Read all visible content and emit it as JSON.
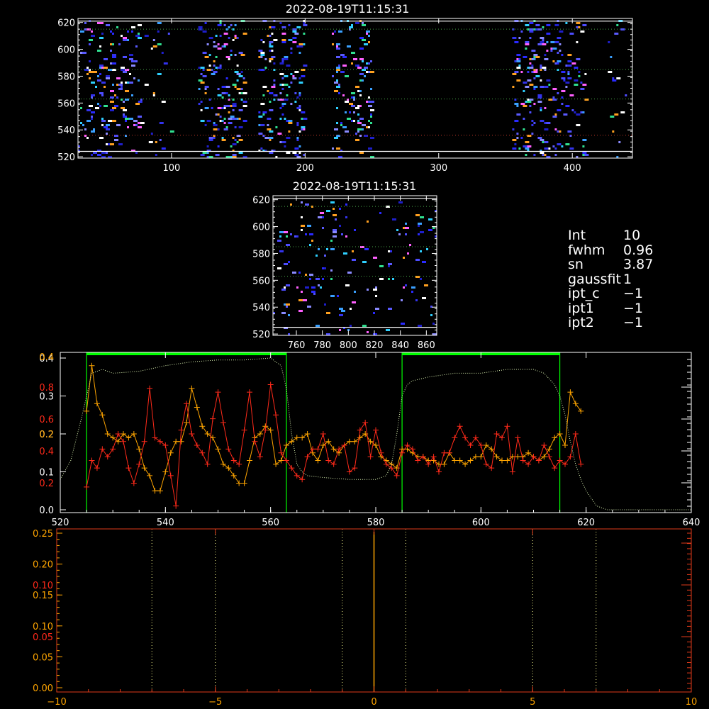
{
  "colors": {
    "axis": "#ffffff",
    "green_dotted": "#4aa84a",
    "red_dotted": "#c0392b",
    "orange": "#ffa500",
    "red": "#ff2a1a",
    "red_axis": "#e03a1a",
    "yellow_dotted": "#f5f58a",
    "lime": "#00ff00",
    "curve_dotted": "#d9f0b0"
  },
  "params": [
    {
      "key": "Int",
      "value": "10"
    },
    {
      "key": "fwhm",
      "value": "0.96"
    },
    {
      "key": "sn",
      "value": "3.87"
    },
    {
      "key": "gaussfit",
      "value": "1"
    },
    {
      "key": "ipt_c",
      "value": "−1"
    },
    {
      "key": "ipt1",
      "value": "−1"
    },
    {
      "key": "ipt2",
      "value": "−1"
    }
  ],
  "chart_data": [
    {
      "type": "heatmap",
      "title": "2022-08-19T11:15:31",
      "xlim": [
        30,
        445
      ],
      "ylim": [
        519,
        623
      ],
      "xticks": [
        100,
        200,
        300,
        400
      ],
      "yticks": [
        520,
        540,
        560,
        580,
        600,
        620
      ],
      "hlines_white": [
        621,
        524
      ],
      "hlines_green": [
        615,
        585,
        563
      ],
      "hlines_red": [
        536
      ],
      "pixel_columns": [
        {
          "x_range": [
            30,
            75
          ],
          "density": 0.3
        },
        {
          "x_range": [
            75,
            100
          ],
          "density": 0.1
        },
        {
          "x_range": [
            120,
            155
          ],
          "density": 0.35
        },
        {
          "x_range": [
            165,
            200
          ],
          "density": 0.35
        },
        {
          "x_range": [
            220,
            250
          ],
          "density": 0.4
        },
        {
          "x_range": [
            355,
            390
          ],
          "density": 0.4
        },
        {
          "x_range": [
            390,
            410
          ],
          "density": 0.25
        },
        {
          "x_range": [
            425,
            440
          ],
          "density": 0.08
        }
      ]
    },
    {
      "type": "heatmap",
      "title": "2022-08-19T11:15:31",
      "xlim": [
        742,
        868
      ],
      "ylim": [
        519,
        623
      ],
      "xticks": [
        760,
        780,
        800,
        820,
        840,
        860
      ],
      "yticks": [
        520,
        540,
        560,
        580,
        600,
        620
      ],
      "hlines_white": [
        621,
        525
      ],
      "hlines_green": [
        615,
        585,
        563
      ],
      "hlines_red": [],
      "pixel_columns": [
        {
          "x_range": [
            742,
            868
          ],
          "density": 0.12
        }
      ]
    },
    {
      "type": "line",
      "xlim": [
        520,
        640
      ],
      "xticks": [
        520,
        540,
        560,
        580,
        600,
        620,
        640
      ],
      "left_axis_white": {
        "ylim": [
          0,
          0.4
        ],
        "ticks": [
          0.0,
          0.1,
          0.2,
          0.3,
          0.4
        ]
      },
      "left_axis_red": {
        "ticks": [
          0.2,
          0.4,
          0.6,
          0.8
        ]
      },
      "left_axis_orange": {
        "ticks": [
          0.2,
          0.4
        ]
      },
      "vlines": [
        525,
        563,
        585,
        615
      ],
      "bands": [
        [
          525,
          563
        ],
        [
          585,
          615
        ]
      ],
      "series": [
        {
          "color": "orange",
          "x": [
            525,
            526,
            527,
            528,
            529,
            530,
            531,
            532,
            533,
            534,
            535,
            536,
            537,
            538,
            539,
            540,
            541,
            542,
            543,
            544,
            545,
            546,
            547,
            548,
            549,
            550,
            551,
            552,
            553,
            554,
            555,
            556,
            557,
            558,
            559,
            560,
            561,
            562,
            563,
            564,
            565,
            566,
            567,
            568,
            569,
            570,
            571,
            572,
            573,
            574,
            575,
            576,
            577,
            578,
            579,
            580,
            581,
            582,
            583,
            584,
            585,
            586,
            587,
            588,
            589,
            590,
            591,
            592,
            593,
            594,
            595,
            596,
            597,
            598,
            599,
            600,
            601,
            602,
            603,
            604,
            605,
            606,
            607,
            608,
            609,
            610,
            611,
            612,
            613,
            614,
            615,
            616,
            617,
            618,
            619
          ],
          "y": [
            0.26,
            0.38,
            0.28,
            0.25,
            0.2,
            0.19,
            0.18,
            0.2,
            0.19,
            0.2,
            0.16,
            0.11,
            0.09,
            0.05,
            0.05,
            0.1,
            0.15,
            0.18,
            0.18,
            0.23,
            0.32,
            0.27,
            0.22,
            0.2,
            0.19,
            0.16,
            0.12,
            0.11,
            0.09,
            0.07,
            0.07,
            0.13,
            0.19,
            0.2,
            0.22,
            0.21,
            0.12,
            0.13,
            0.17,
            0.18,
            0.19,
            0.19,
            0.2,
            0.15,
            0.13,
            0.17,
            0.18,
            0.16,
            0.15,
            0.17,
            0.18,
            0.18,
            0.19,
            0.2,
            0.18,
            0.17,
            0.14,
            0.13,
            0.12,
            0.11,
            0.16,
            0.16,
            0.15,
            0.14,
            0.14,
            0.13,
            0.13,
            0.12,
            0.12,
            0.15,
            0.13,
            0.13,
            0.12,
            0.13,
            0.14,
            0.14,
            0.17,
            0.16,
            0.14,
            0.13,
            0.13,
            0.14,
            0.14,
            0.14,
            0.15,
            0.14,
            0.13,
            0.14,
            0.16,
            0.19,
            0.2,
            0.17,
            0.31,
            0.28,
            0.26
          ]
        },
        {
          "color": "red",
          "x": [
            525,
            526,
            527,
            528,
            529,
            530,
            531,
            532,
            533,
            534,
            535,
            536,
            537,
            538,
            539,
            540,
            541,
            542,
            543,
            544,
            545,
            546,
            547,
            548,
            549,
            550,
            551,
            552,
            553,
            554,
            555,
            556,
            557,
            558,
            559,
            560,
            561,
            562,
            563,
            564,
            565,
            566,
            567,
            568,
            569,
            570,
            571,
            572,
            573,
            574,
            575,
            576,
            577,
            578,
            579,
            580,
            581,
            582,
            583,
            584,
            585,
            586,
            587,
            588,
            589,
            590,
            591,
            592,
            593,
            594,
            595,
            596,
            597,
            598,
            599,
            600,
            601,
            602,
            603,
            604,
            605,
            606,
            607,
            608,
            609,
            610,
            611,
            612,
            613,
            614,
            615,
            616,
            617,
            618,
            619
          ],
          "y": [
            0.06,
            0.13,
            0.11,
            0.16,
            0.14,
            0.16,
            0.2,
            0.18,
            0.11,
            0.07,
            0.12,
            0.18,
            0.32,
            0.19,
            0.18,
            0.17,
            0.09,
            0.01,
            0.21,
            0.28,
            0.2,
            0.17,
            0.15,
            0.12,
            0.24,
            0.31,
            0.23,
            0.16,
            0.13,
            0.12,
            0.21,
            0.31,
            0.18,
            0.14,
            0.21,
            0.33,
            0.25,
            0.15,
            0.13,
            0.11,
            0.09,
            0.08,
            0.14,
            0.16,
            0.16,
            0.2,
            0.13,
            0.12,
            0.16,
            0.17,
            0.1,
            0.11,
            0.21,
            0.23,
            0.14,
            0.21,
            0.15,
            0.12,
            0.11,
            0.09,
            0.15,
            0.17,
            0.16,
            0.13,
            0.14,
            0.12,
            0.14,
            0.1,
            0.15,
            0.15,
            0.19,
            0.22,
            0.19,
            0.17,
            0.19,
            0.17,
            0.12,
            0.11,
            0.2,
            0.19,
            0.22,
            0.1,
            0.19,
            0.13,
            0.12,
            0.14,
            0.13,
            0.17,
            0.14,
            0.11,
            0.13,
            0.12,
            0.14,
            0.2,
            0.12
          ]
        },
        {
          "color": "curve_dotted",
          "x": [
            520,
            522,
            524,
            525,
            526,
            528,
            530,
            535,
            540,
            545,
            550,
            555,
            560,
            562,
            563,
            564,
            565,
            566,
            567,
            570,
            575,
            580,
            582,
            583,
            584,
            585,
            586,
            587,
            590,
            595,
            600,
            605,
            610,
            612,
            614,
            615,
            616,
            617,
            618,
            619,
            620,
            622,
            624,
            626,
            630,
            635,
            640
          ],
          "y": [
            0.08,
            0.13,
            0.24,
            0.3,
            0.36,
            0.37,
            0.36,
            0.365,
            0.38,
            0.39,
            0.395,
            0.395,
            0.4,
            0.38,
            0.32,
            0.2,
            0.12,
            0.1,
            0.09,
            0.085,
            0.08,
            0.08,
            0.09,
            0.12,
            0.2,
            0.3,
            0.33,
            0.34,
            0.35,
            0.36,
            0.36,
            0.37,
            0.37,
            0.36,
            0.33,
            0.3,
            0.25,
            0.18,
            0.12,
            0.08,
            0.05,
            0.01,
            0.0,
            0.0,
            0.0,
            0.0,
            0.0
          ]
        }
      ]
    },
    {
      "type": "line",
      "xlim": [
        -10,
        10
      ],
      "xticks": [
        -10,
        -5,
        0,
        5,
        10
      ],
      "left_axis_orange": {
        "ylim": [
          0,
          0.25
        ],
        "ticks": [
          0.0,
          0.05,
          0.1,
          0.15,
          0.2,
          0.25
        ]
      },
      "left_axis_red": {
        "ticks": [
          0.05,
          0.1
        ]
      },
      "vlines_dotted": [
        -7,
        -5,
        -1,
        1,
        5,
        7
      ],
      "vline_solid": [
        0
      ]
    }
  ]
}
